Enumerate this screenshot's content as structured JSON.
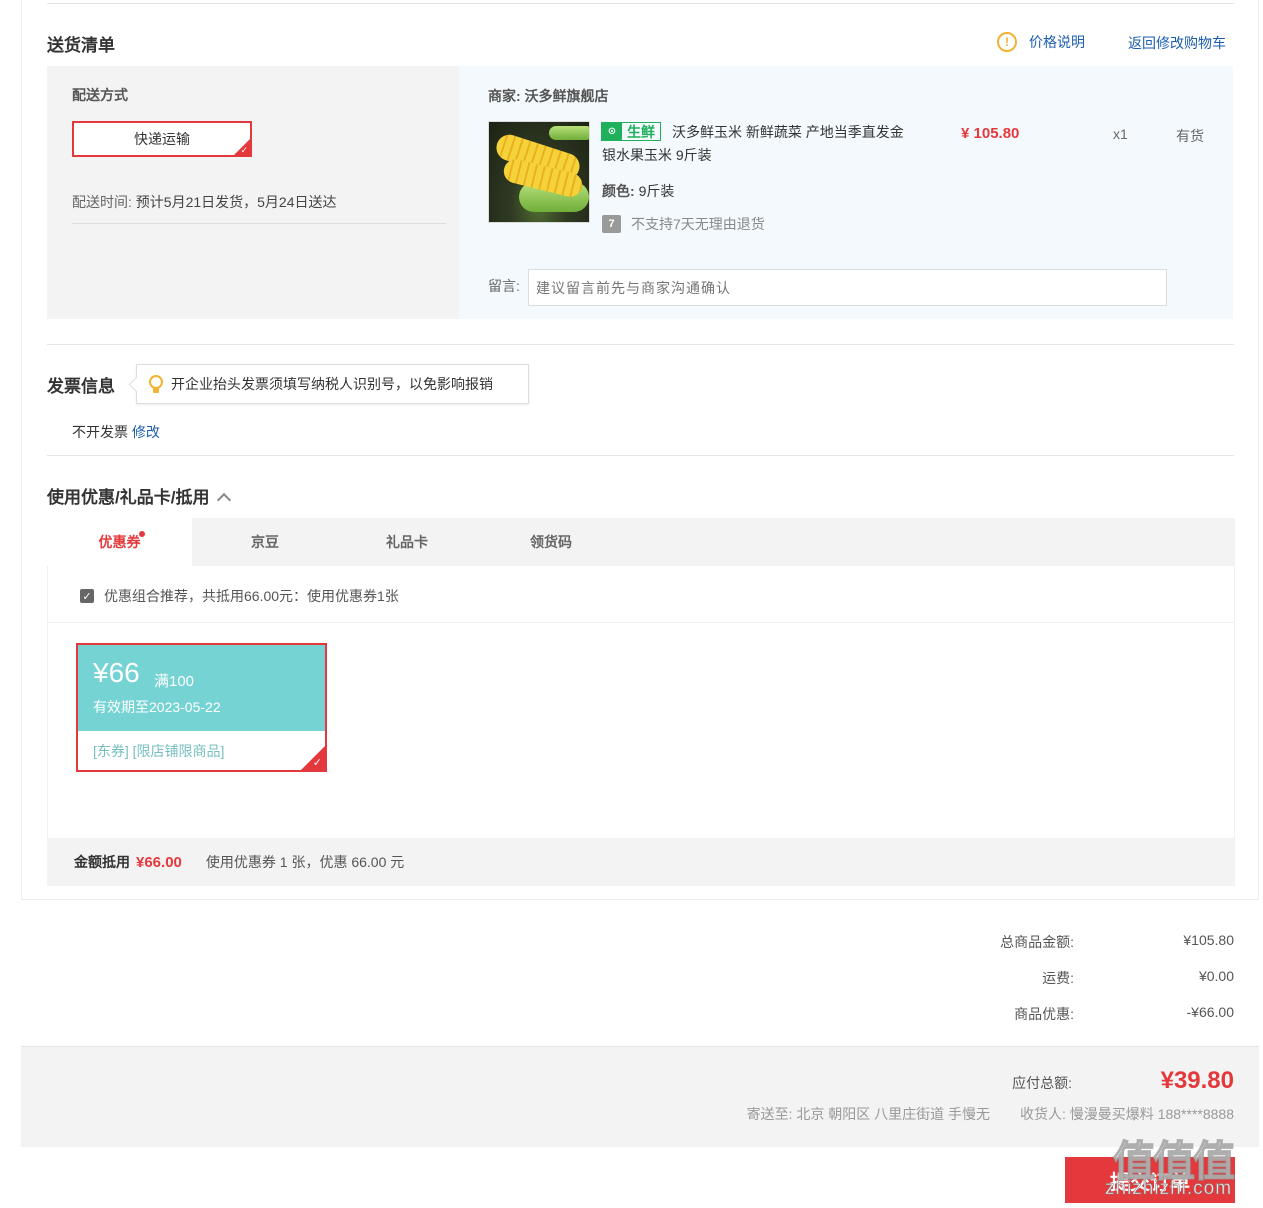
{
  "delivery": {
    "title": "送货清单",
    "price_note": "价格说明",
    "back_to_cart": "返回修改购物车",
    "method_label": "配送方式",
    "method_value": "快递运输",
    "time_label": "配送时间:",
    "time_value": "预计5月21日发货，5月24日送达"
  },
  "order_item": {
    "merchant": "商家: 沃多鲜旗舰店",
    "tag": "生鲜",
    "name": "沃多鲜玉米 新鲜蔬菜 产地当季直发金银水果玉米 9斤装",
    "color_label": "颜色:",
    "color_value": "9斤装",
    "return_policy": "不支持7天无理由退货",
    "price": "¥ 105.80",
    "qty": "x1",
    "stock": "有货",
    "message_label": "留言:",
    "message_placeholder": "建议留言前先与商家沟通确认"
  },
  "invoice": {
    "title": "发票信息",
    "tip": "开企业抬头发票须填写纳税人识别号，以免影响报销",
    "status": "不开发票",
    "edit": "修改"
  },
  "discounts": {
    "title": "使用优惠/礼品卡/抵用",
    "tabs": [
      "优惠券",
      "京豆",
      "礼品卡",
      "领货码"
    ],
    "combo_text": "优惠组合推荐，共抵用66.00元：使用优惠券1张",
    "coupon": {
      "amount": "¥66",
      "threshold": "满100",
      "valid": "有效期至2023-05-22",
      "scope": "[东券] [限店铺限商品]",
      "color": "#76d3d3"
    },
    "summary_label": "金额抵用",
    "summary_amount": "¥66.00",
    "summary_text": "使用优惠券 1 张，优惠 66.00 元"
  },
  "totals": {
    "goods_label": "总商品金额:",
    "goods_value": "¥105.80",
    "shipping_label": "运费:",
    "shipping_value": "¥0.00",
    "discount_label": "商品优惠:",
    "discount_value": "-¥66.00"
  },
  "payment": {
    "payable_label": "应付总额:",
    "payable_value": "¥39.80",
    "address": "寄送至: 北京 朝阳区 八里庄街道 手慢无",
    "receiver": "收货人: 慢漫曼买爆料 188****8888",
    "submit": "提交订单"
  },
  "watermark": {
    "big": "值值值",
    "small": "zhizhizhi.com"
  },
  "colors": {
    "accent": "#e4393c",
    "link": "#1c5db0",
    "fresh": "#1eb05a"
  }
}
